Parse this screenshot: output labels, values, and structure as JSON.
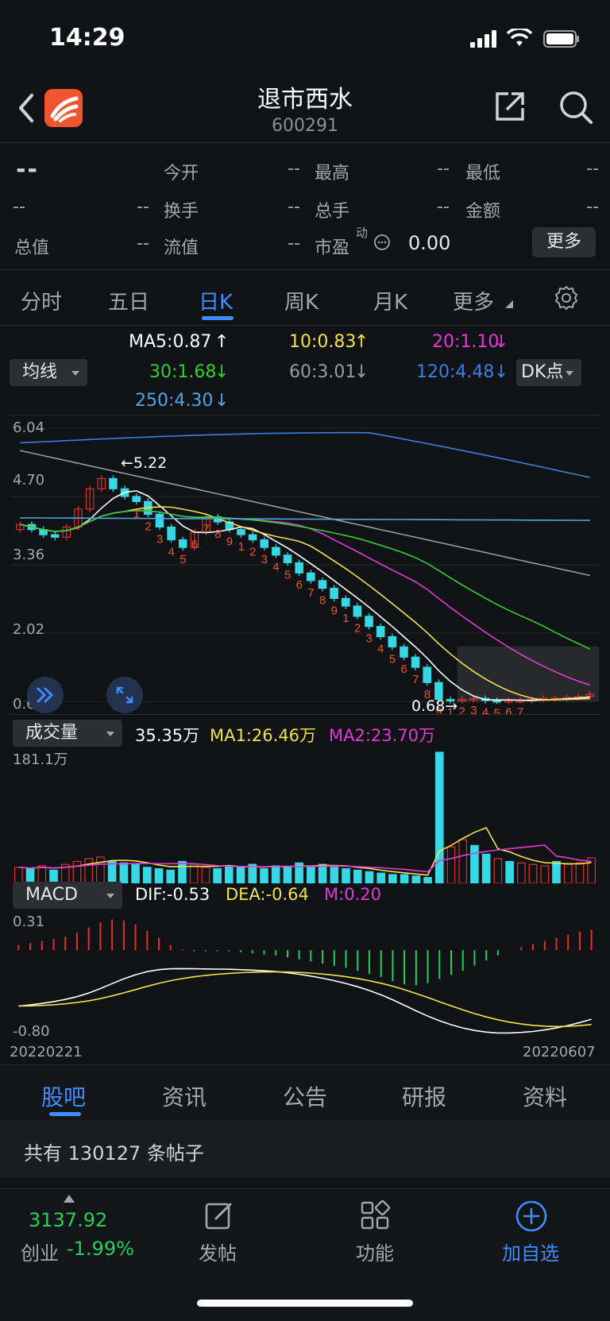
{
  "status": {
    "time": "14:29"
  },
  "header": {
    "title": "退市西水",
    "code": "600291"
  },
  "quote": {
    "price": "--",
    "open_label": "今开",
    "open": "--",
    "high_label": "最高",
    "high": "--",
    "low_label": "最低",
    "low": "--",
    "change": "--",
    "change_pct": "--",
    "turnover_label": "换手",
    "turnover": "--",
    "volume_label": "总手",
    "volume": "--",
    "amount_label": "金额",
    "amount": "--",
    "mcap_label": "总值",
    "mcap": "--",
    "float_label": "流值",
    "float": "--",
    "pe_label": "市盈",
    "pe_sup": "动",
    "pe": "0.00",
    "more": "更多"
  },
  "tabs": [
    "分时",
    "五日",
    "日K",
    "周K",
    "月K",
    "更多"
  ],
  "active_tab": "日K",
  "ma": {
    "dropdown": "均线",
    "ma5": "MA5:0.87",
    "ma10": "10:0.83",
    "ma20": "20:1.10",
    "ma30": "30:1.68",
    "ma60": "60:3.01",
    "ma120": "120:4.48",
    "ma250": "250:4.30",
    "dk": "DK点",
    "arrow_up": "↑",
    "arrow_down": "↓"
  },
  "colors": {
    "up": "#e0302a",
    "down": "#37d8e6",
    "ma5": "#ffffff",
    "ma10": "#f2e24a",
    "ma20": "#e03ad8",
    "ma30": "#2fd02f",
    "ma60": "#9a9a9a",
    "ma120": "#3a7fe0",
    "ma250": "#4aa8e8",
    "accent": "#3d8dff",
    "green": "#23d15a"
  },
  "chart_data": [
    {
      "type": "candlestick",
      "title": "日K",
      "y_ticks": [
        "6.04",
        "4.70",
        "3.36",
        "2.02",
        "0.68"
      ],
      "ylim": [
        0.68,
        6.04
      ],
      "annotations": {
        "high": "←5.22",
        "low": "0.68→"
      },
      "td_count_labels": [
        "1",
        "2",
        "3",
        "4",
        "5",
        "6",
        "7",
        "8",
        "9",
        "1",
        "2",
        "3",
        "4",
        "5",
        "6",
        "7",
        "8",
        "9",
        "1",
        "2",
        "3",
        "4",
        "5",
        "6",
        "7",
        "8",
        "9",
        "1",
        "2",
        "3",
        "4",
        "5",
        "6",
        "7"
      ],
      "x_range": [
        "20220221",
        "20220607"
      ],
      "close": [
        4.15,
        4.05,
        3.95,
        3.9,
        4.1,
        4.45,
        4.85,
        5.05,
        4.85,
        4.7,
        4.6,
        4.35,
        4.1,
        3.85,
        3.7,
        4.0,
        4.3,
        4.2,
        4.05,
        3.95,
        3.85,
        3.7,
        3.55,
        3.4,
        3.2,
        3.05,
        2.9,
        2.7,
        2.55,
        2.35,
        2.15,
        1.95,
        1.75,
        1.55,
        1.35,
        1.05,
        0.72,
        0.7,
        0.72,
        0.74,
        0.7,
        0.69,
        0.7,
        0.7,
        0.72,
        0.74,
        0.74,
        0.76,
        0.78,
        0.82
      ],
      "open": [
        4.05,
        4.15,
        4.05,
        3.95,
        3.9,
        4.1,
        4.45,
        4.85,
        5.05,
        4.85,
        4.7,
        4.6,
        4.35,
        4.1,
        3.85,
        3.7,
        4.0,
        4.3,
        4.2,
        4.05,
        3.95,
        3.85,
        3.7,
        3.55,
        3.4,
        3.2,
        3.05,
        2.9,
        2.7,
        2.55,
        2.35,
        2.15,
        1.95,
        1.75,
        1.55,
        1.35,
        1.05,
        0.72,
        0.7,
        0.72,
        0.74,
        0.7,
        0.69,
        0.7,
        0.7,
        0.72,
        0.74,
        0.74,
        0.76,
        0.78
      ]
    },
    {
      "type": "bar",
      "title": "成交量",
      "y_ticks": [
        "181.1万"
      ],
      "ylim": [
        0,
        181.1
      ],
      "current": "35.35万",
      "ma1": "MA1:26.46万",
      "ma2": "MA2:23.70万",
      "values": [
        22,
        20,
        24,
        18,
        26,
        30,
        34,
        36,
        30,
        28,
        26,
        22,
        20,
        18,
        30,
        26,
        22,
        20,
        24,
        22,
        26,
        20,
        24,
        22,
        28,
        24,
        26,
        22,
        20,
        18,
        16,
        14,
        12,
        12,
        10,
        8,
        180,
        50,
        60,
        52,
        40,
        34,
        30,
        28,
        26,
        24,
        30,
        26,
        28,
        35
      ],
      "up": [
        1,
        0,
        1,
        0,
        1,
        1,
        1,
        1,
        0,
        0,
        0,
        0,
        0,
        0,
        0,
        1,
        1,
        0,
        0,
        0,
        0,
        0,
        0,
        0,
        0,
        0,
        0,
        0,
        0,
        0,
        0,
        0,
        0,
        0,
        0,
        0,
        0,
        1,
        1,
        0,
        0,
        1,
        0,
        1,
        1,
        1,
        0,
        1,
        1,
        1
      ]
    },
    {
      "type": "bar",
      "title": "MACD",
      "y_ticks": [
        "0.31",
        "-0.80"
      ],
      "ylim": [
        -0.8,
        0.31
      ],
      "dif": "DIF:-0.53",
      "dea": "DEA:-0.64",
      "m": "M:0.20",
      "hist": [
        0.05,
        0.07,
        0.09,
        0.11,
        0.13,
        0.17,
        0.22,
        0.27,
        0.3,
        0.29,
        0.25,
        0.19,
        0.12,
        0.05,
        0.01,
        -0.01,
        -0.01,
        -0.01,
        -0.01,
        -0.02,
        -0.03,
        -0.04,
        -0.05,
        -0.07,
        -0.09,
        -0.11,
        -0.13,
        -0.15,
        -0.17,
        -0.2,
        -0.23,
        -0.26,
        -0.3,
        -0.33,
        -0.34,
        -0.32,
        -0.28,
        -0.24,
        -0.2,
        -0.15,
        -0.1,
        -0.05,
        0.0,
        0.03,
        0.06,
        0.09,
        0.12,
        0.15,
        0.18,
        0.2
      ]
    }
  ],
  "subtabs": [
    "股吧",
    "资讯",
    "公告",
    "研报",
    "资料"
  ],
  "posts": {
    "count_text": "共有 130127 条帖子"
  },
  "bottom": {
    "index_value": "3137.92",
    "index_name": "创业",
    "index_change": "-1.99%",
    "post": "发帖",
    "functions": "功能",
    "add_watch": "加自选"
  }
}
